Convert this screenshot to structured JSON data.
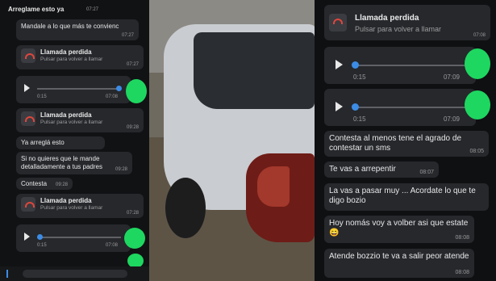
{
  "left_panel": {
    "header_text": "Arreglame esto ya",
    "header_time": "07:27",
    "messages": [
      {
        "text": "Mandale a lo que más te convienc",
        "time": "07:27"
      },
      {
        "type": "call",
        "title": "Llamada perdida",
        "subtitle": "Pulsar para volver a llamar",
        "time": "07:27"
      },
      {
        "type": "voice",
        "elapsed": "0:15",
        "time": "07:08"
      },
      {
        "type": "call",
        "title": "Llamada perdida",
        "subtitle": "Pulsar para volver a llamar",
        "time": "09:28"
      },
      {
        "text": "Ya arreglá esto",
        "time": "09:28"
      },
      {
        "text": "Si no quieres que le mande detalladamente a tus padres",
        "time": "09:28"
      },
      {
        "text": "Contesta",
        "time": "09:28"
      },
      {
        "type": "call",
        "title": "Llamada perdida",
        "subtitle": "Pulsar para volver a llamar",
        "time": "07:28"
      },
      {
        "type": "voice",
        "elapsed": "0:15",
        "time": "07:08"
      }
    ]
  },
  "right_panel": {
    "messages": [
      {
        "type": "call",
        "title": "Llamada perdida",
        "subtitle": "Pulsar para volver a llamar",
        "time": "07:08"
      },
      {
        "type": "voice",
        "elapsed": "0:15",
        "time": "07:09"
      },
      {
        "type": "voice",
        "elapsed": "0:15",
        "time": "07:09"
      },
      {
        "text": "Contesta al menos tene el agrado de contestar un sms",
        "time": "08:05"
      },
      {
        "text": "Te vas a arrepentir",
        "time": "08:07"
      },
      {
        "text": "La vas a pasar muy ... Acordate lo que te digo bozio",
        "time": "08:08"
      },
      {
        "text": "Hoy nomás voy a volber asi que estate 😄",
        "time": "08:08"
      },
      {
        "text": "Atende bozzio te va a salir peor atende",
        "time": "08:08"
      }
    ]
  },
  "colors": {
    "bubble": "#26282c",
    "accent_blue": "#3c8ce6",
    "missed_call_red": "#e0463c",
    "avatar_green": "#1ed760"
  },
  "icons": {
    "missed_call": "missed-call-icon",
    "play": "play-icon"
  }
}
